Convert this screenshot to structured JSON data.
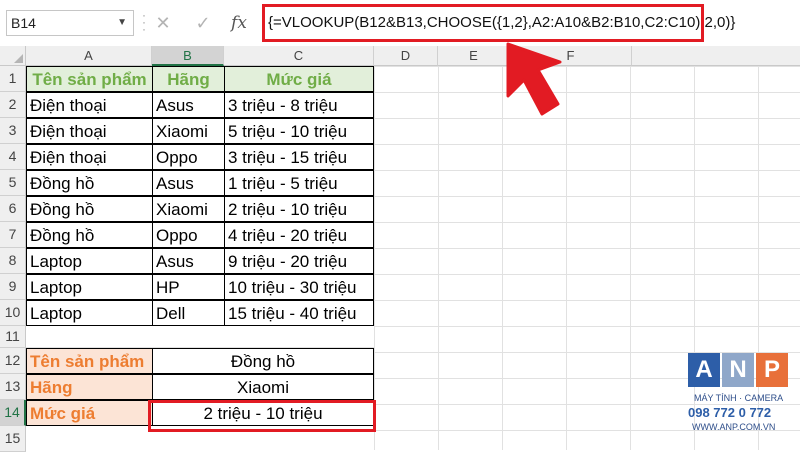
{
  "formula_bar": {
    "name_box": "B14",
    "cancel_icon": "✕",
    "enter_icon": "✓",
    "fx_label": "fx",
    "formula": "{=VLOOKUP(B12&B13,CHOOSE({1,2},A2:A10&B2:B10,C2:C10),2,0)}"
  },
  "columns": [
    "A",
    "B",
    "C",
    "D",
    "E",
    "F"
  ],
  "rows": [
    "1",
    "2",
    "3",
    "4",
    "5",
    "6",
    "7",
    "8",
    "9",
    "10",
    "11",
    "12",
    "13",
    "14",
    "15"
  ],
  "header": [
    "Tên sản phẩm",
    "Hãng",
    "Mức giá"
  ],
  "table": [
    [
      "Điện thoại",
      "Asus",
      "3 triệu - 8 triệu"
    ],
    [
      "Điện thoại",
      "Xiaomi",
      "5 triệu - 10 triệu"
    ],
    [
      "Điện thoại",
      "Oppo",
      "3 triệu - 15 triệu"
    ],
    [
      "Đồng hồ",
      "Asus",
      "1 triệu - 5 triệu"
    ],
    [
      "Đồng hồ",
      "Xiaomi",
      "2 triệu - 10 triệu"
    ],
    [
      "Đồng hồ",
      "Oppo",
      "4 triệu - 20 triệu"
    ],
    [
      "Laptop",
      "Asus",
      "9 triệu - 20 triệu"
    ],
    [
      "Laptop",
      "HP",
      "10 triệu - 30 triệu"
    ],
    [
      "Laptop",
      "Dell",
      "15 triệu - 40 triệu"
    ]
  ],
  "lookup": [
    {
      "label": "Tên sản phẩm",
      "value": "Đồng hồ"
    },
    {
      "label": "Hãng",
      "value": "Xiaomi"
    },
    {
      "label": "Mức giá",
      "value": "2 triệu - 10 triệu"
    }
  ],
  "colors": {
    "header_fill": "#e2efda",
    "header_text": "#70ad47",
    "label_fill": "#fce4d6",
    "label_text": "#ed7d31",
    "highlight": "#e21b23"
  },
  "logo": {
    "letters": [
      "A",
      "N",
      "P"
    ],
    "tagline": "MÁY TÍNH · CAMERA",
    "phone": "098 772 0 772",
    "website": "WWW.ANP.COM.VN"
  }
}
